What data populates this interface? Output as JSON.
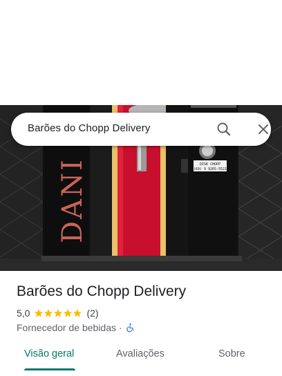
{
  "search": {
    "query": "Barões do Chopp Delivery"
  },
  "place": {
    "name": "Barões do Chopp Delivery",
    "rating": "5,0",
    "stars": 5,
    "review_count": "(2)",
    "category": "Fornecedor de bebidas",
    "separator": "·",
    "accessibility_icon": "wheelchair-icon"
  },
  "photo": {
    "machine_text": "DANI",
    "sticker_line1": "DISK CHOPP",
    "sticker_line2": "(69) 9 9265-5521"
  },
  "tabs": [
    {
      "label": "Visão geral",
      "active": true
    },
    {
      "label": "Avaliações",
      "active": false
    },
    {
      "label": "Sobre",
      "active": false
    }
  ],
  "colors": {
    "accent": "#00796b",
    "star": "#fbbc04",
    "accessibility": "#1a73e8"
  }
}
